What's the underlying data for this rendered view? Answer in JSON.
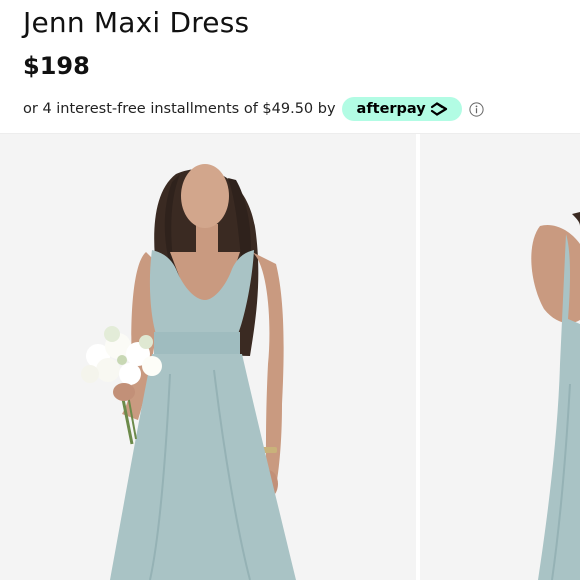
{
  "product": {
    "title": "Jenn Maxi Dress",
    "price": "$198"
  },
  "afterpay": {
    "text": "or 4 interest-free installments of $49.50 by",
    "badge_label": "afterpay",
    "badge_color": "#b2fce4",
    "info_icon": "info-circle-icon"
  },
  "gallery": {
    "images": [
      {
        "alt": "Model wearing dusty blue maxi dress holding white bouquet"
      },
      {
        "alt": "Second view of dusty blue maxi dress"
      }
    ],
    "dress_color": "#a9c3c5"
  }
}
